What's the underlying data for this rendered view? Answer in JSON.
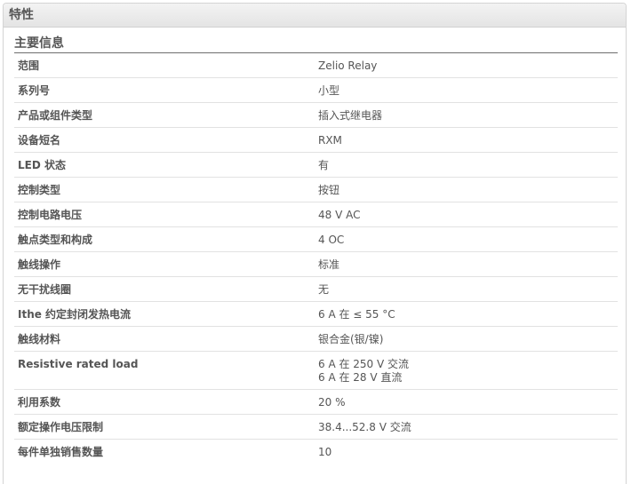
{
  "panel": {
    "title": "特性"
  },
  "section": {
    "title": "主要信息"
  },
  "rows": [
    {
      "label": "范围",
      "value": "Zelio Relay"
    },
    {
      "label": "系列号",
      "value": "小型"
    },
    {
      "label": "产品或组件类型",
      "value": "插入式继电器"
    },
    {
      "label": "设备短名",
      "value": "RXM"
    },
    {
      "label": "LED 状态",
      "value": "有"
    },
    {
      "label": "控制类型",
      "value": "按钮"
    },
    {
      "label": "控制电路电压",
      "value": "48 V AC"
    },
    {
      "label": "触点类型和构成",
      "value": "4 OC"
    },
    {
      "label": "触线操作",
      "value": "标准"
    },
    {
      "label": "无干扰线圈",
      "value": "无"
    },
    {
      "label": "Ithe 约定封闭发热电流",
      "value": "6 A 在 ≤ 55 °C"
    },
    {
      "label": "触线材料",
      "value": "银合金(银/镍)"
    },
    {
      "label": "Resistive rated load",
      "value": "6 A 在 250 V 交流\n6 A 在 28 V 直流"
    },
    {
      "label": "利用系数",
      "value": "20 %"
    },
    {
      "label": "额定操作电压限制",
      "value": "38.4...52.8 V 交流"
    },
    {
      "label": "每件单独销售数量",
      "value": "10"
    }
  ]
}
